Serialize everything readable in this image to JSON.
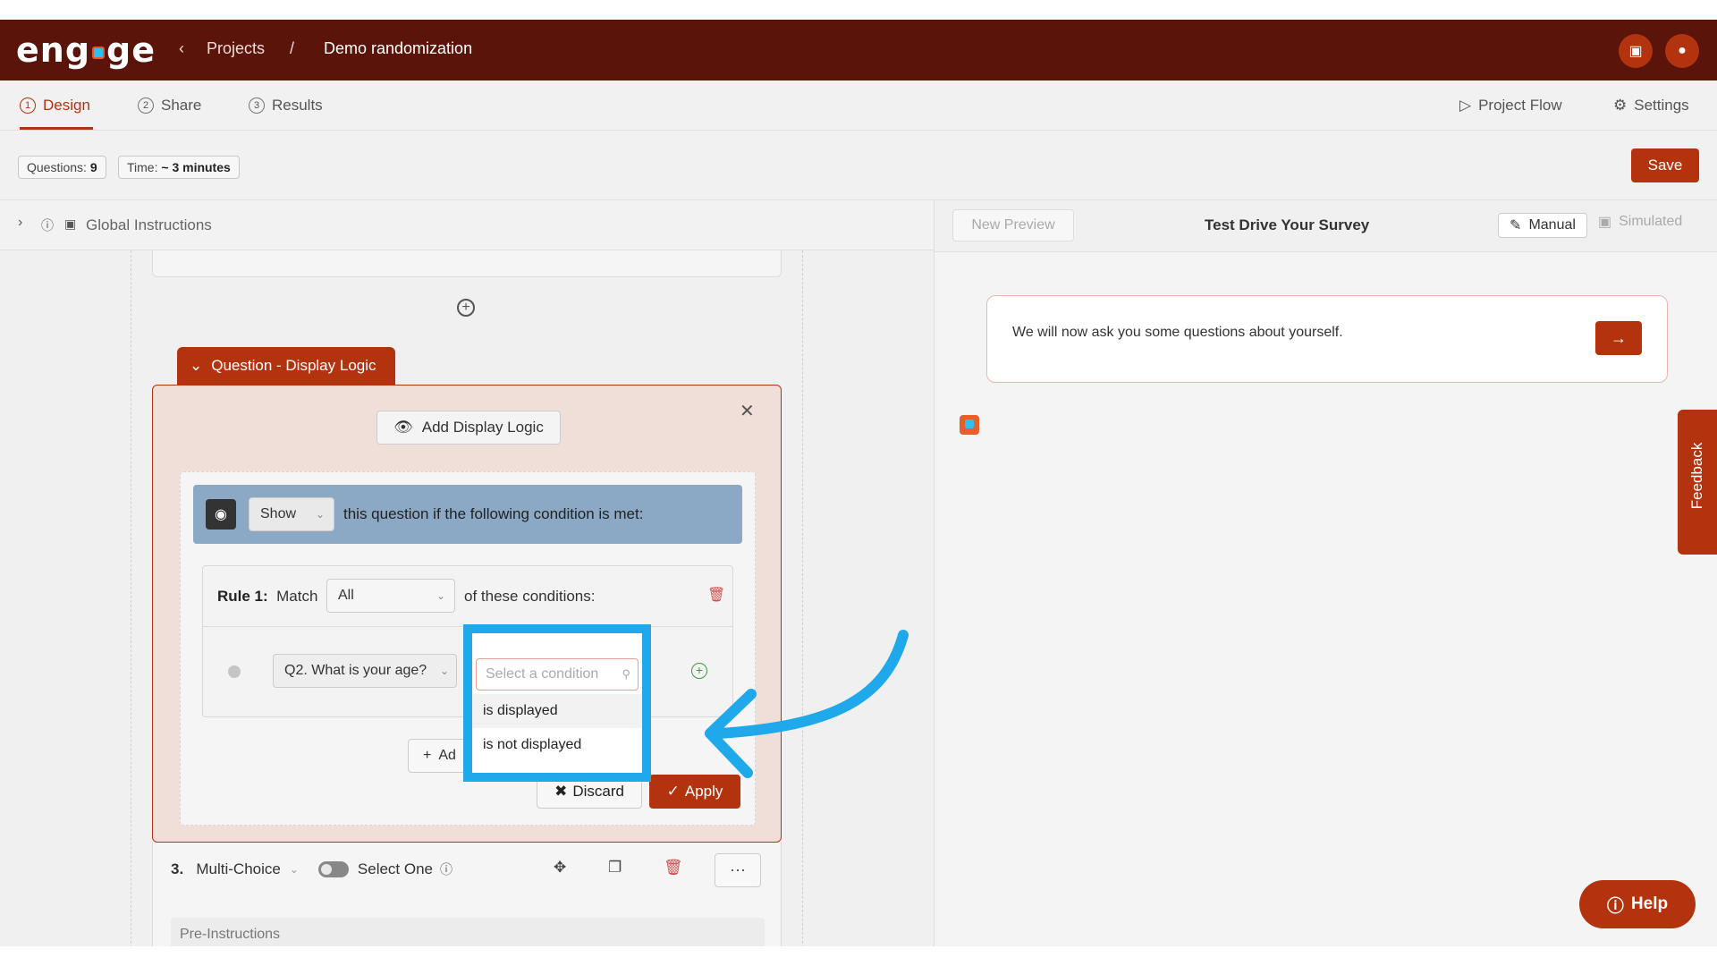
{
  "header": {
    "logo": "engage",
    "back_crumb": "Projects",
    "separator": "/",
    "project_name": "Demo randomization"
  },
  "tabs": {
    "design": {
      "num": "1",
      "label": "Design"
    },
    "share": {
      "num": "2",
      "label": "Share"
    },
    "results": {
      "num": "3",
      "label": "Results"
    },
    "project_flow": "Project Flow",
    "settings": "Settings"
  },
  "info": {
    "questions_label": "Questions:",
    "questions_value": "9",
    "time_label": "Time:",
    "time_value": "~ 3 minutes",
    "save": "Save"
  },
  "global_instructions": "Global Instructions",
  "display_logic": {
    "tab_label": "Question - Display Logic",
    "add_button": "Add Display Logic",
    "show_select": "Show",
    "show_text": "this question if the following condition is met:",
    "rule_prefix": "Rule 1:",
    "rule_match": "Match",
    "match_select": "All",
    "rule_suffix": "of these conditions:",
    "question_select": "Q2. What is your age?",
    "add_rule": "Ad",
    "discard": "Discard",
    "apply": "Apply"
  },
  "condition_dropdown": {
    "placeholder": "Select a condition",
    "options": [
      "is displayed",
      "is not displayed"
    ]
  },
  "question3": {
    "number": "3.",
    "type": "Multi-Choice",
    "select_one": "Select One",
    "more": "···",
    "pre_instructions": "Pre-Instructions"
  },
  "preview": {
    "new_preview": "New Preview",
    "title": "Test Drive Your Survey",
    "manual": "Manual",
    "simulated": "Simulated",
    "message": "We will now ask you some questions about yourself."
  },
  "feedback": "Feedback",
  "help": "Help",
  "colors": {
    "brand": "#b4330f",
    "header": "#5a140a",
    "highlight": "#1fa8ea"
  }
}
